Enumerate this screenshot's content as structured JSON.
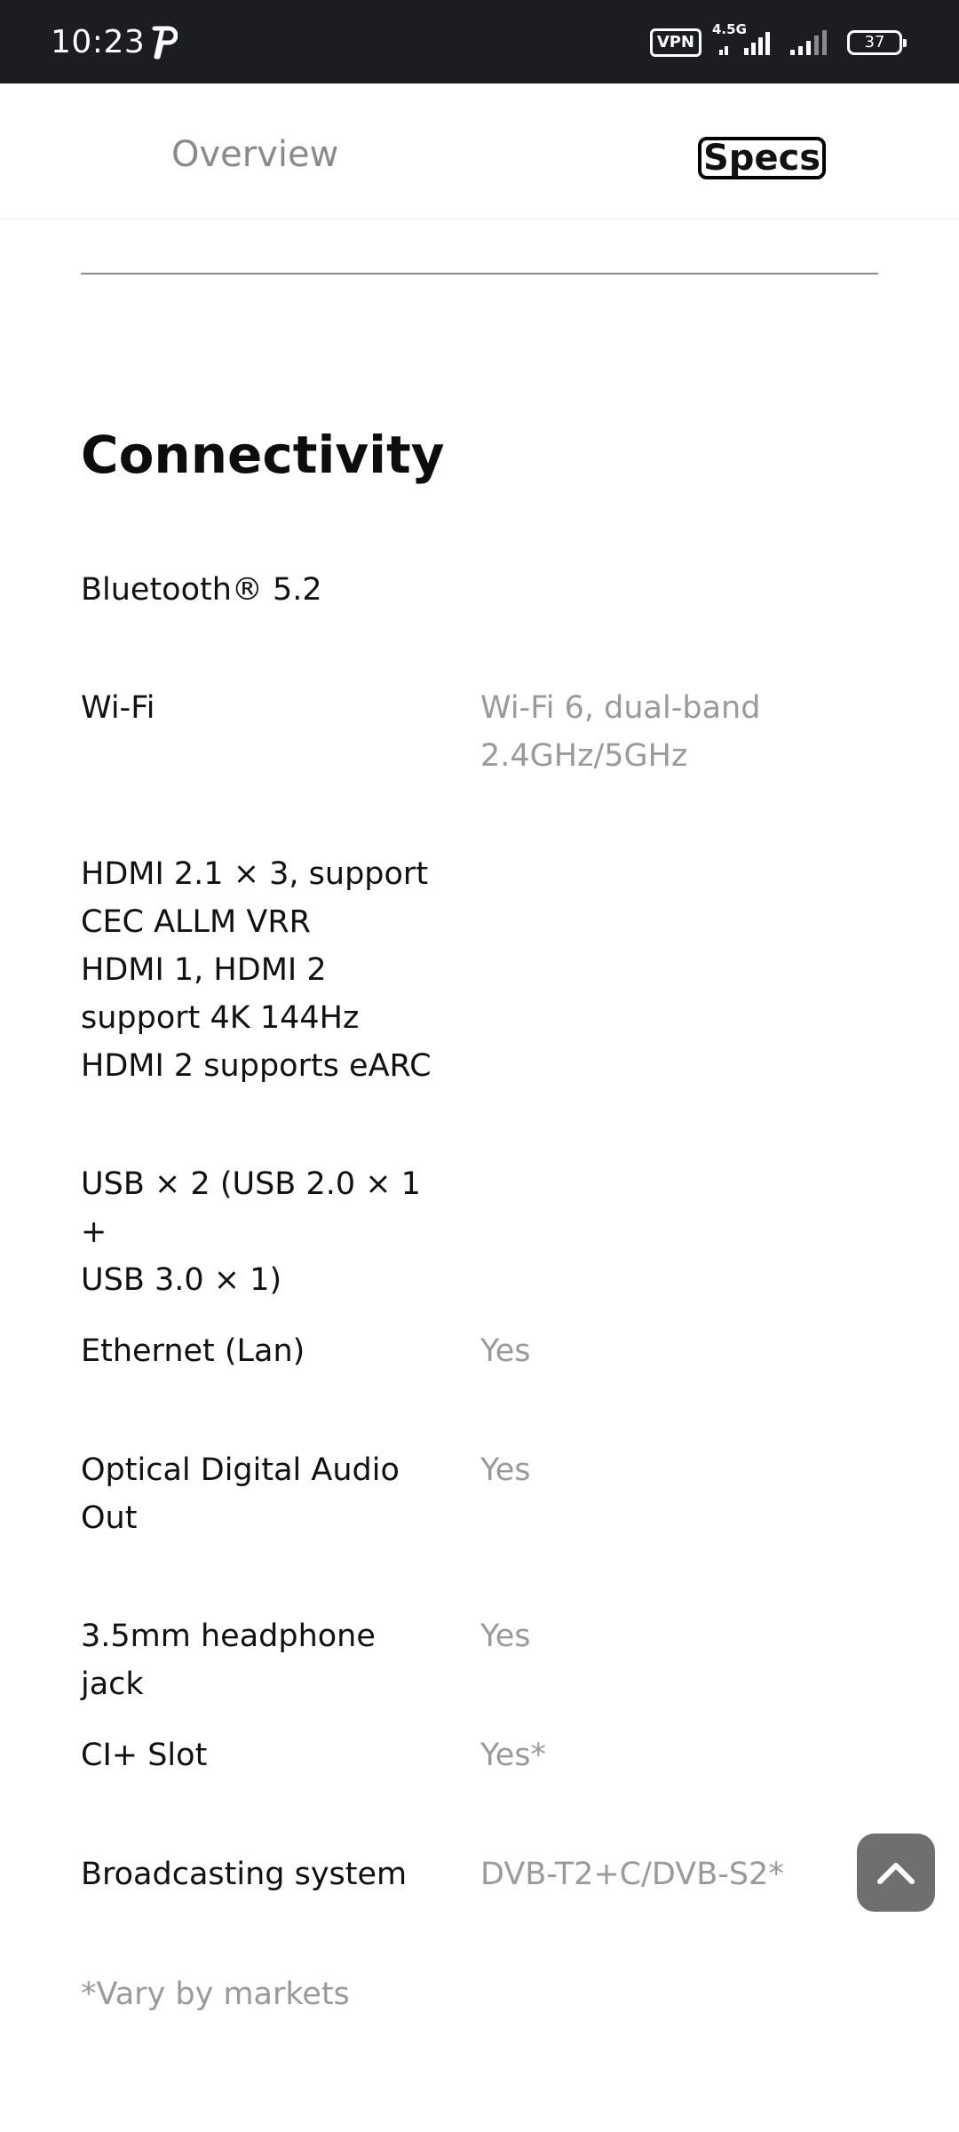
{
  "status_bar": {
    "time": "10:23",
    "vpn": "VPN",
    "network": "4.5G",
    "battery": "37"
  },
  "tabs": [
    {
      "label": "Overview",
      "active": false
    },
    {
      "label": "Specs",
      "active": true
    }
  ],
  "section": {
    "title": "Connectivity"
  },
  "specs": [
    {
      "label": "Bluetooth® 5.2",
      "value": ""
    },
    {
      "label": "Wi-Fi",
      "value": "Wi-Fi 6, dual-band\n2.4GHz/5GHz"
    },
    {
      "label": "HDMI 2.1 × 3, support\nCEC ALLM VRR\nHDMI 1, HDMI 2\nsupport 4K 144Hz\nHDMI 2 supports eARC",
      "value": ""
    },
    {
      "label": "USB × 2 (USB 2.0 × 1 +\nUSB 3.0 × 1)",
      "value": ""
    },
    {
      "label": "Ethernet (Lan)",
      "value": "Yes"
    },
    {
      "label": "Optical Digital Audio\nOut",
      "value": "Yes"
    },
    {
      "label": "3.5mm headphone jack",
      "value": "Yes"
    },
    {
      "label": "CI+ Slot",
      "value": "Yes*"
    },
    {
      "label": "Broadcasting system",
      "value": "DVB-T2+C/DVB-S2*"
    }
  ],
  "footnote": "*Vary by markets",
  "icons": {
    "status_p": "p-notification-icon",
    "signal": "signal-icon",
    "scroll_top": "chevron-up-icon"
  },
  "colors": {
    "status_bar_bg": "#1b1d22",
    "value_text": "#9a9a9a",
    "scroll_button": "#6f6f6f"
  }
}
